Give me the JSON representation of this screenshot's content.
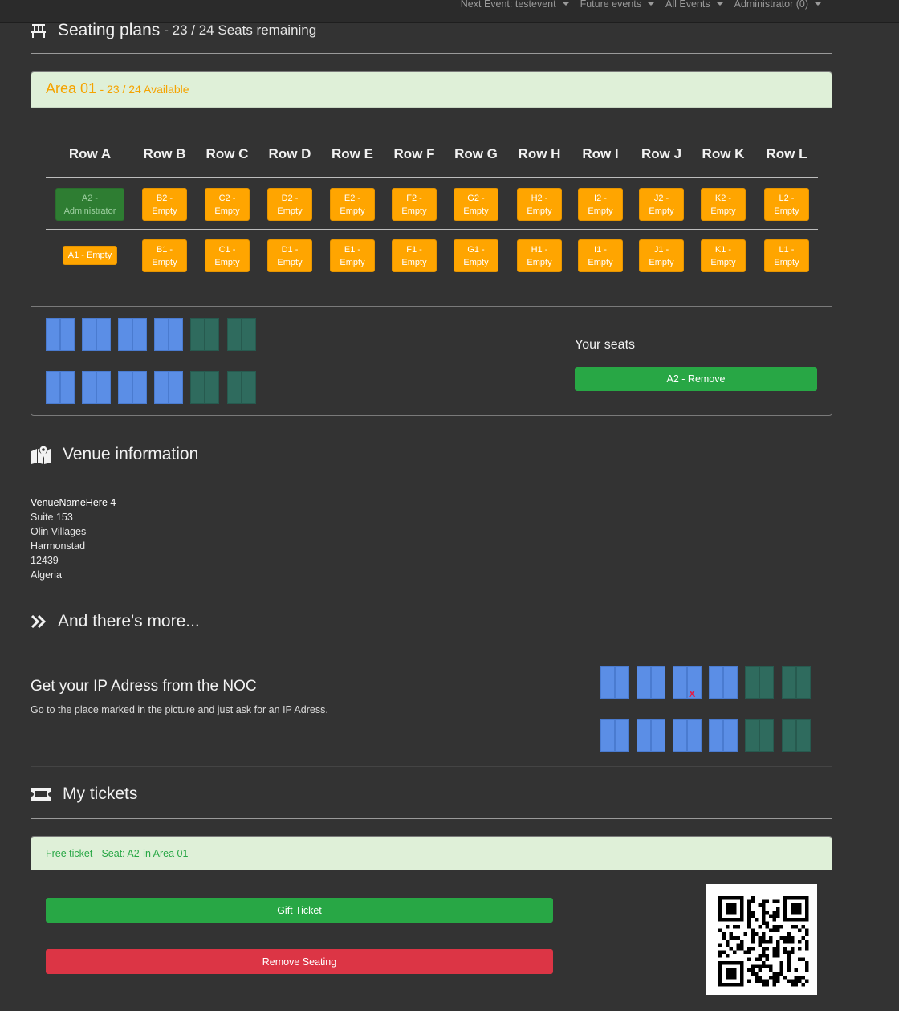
{
  "nav": {
    "next_event": "Next Event: testevent",
    "future_events": "Future events",
    "all_events": "All Events",
    "user": "Administrator (0)"
  },
  "seating": {
    "title": "Seating plans",
    "subtitle": "- 23 / 24 Seats remaining",
    "icon": "chair-icon",
    "area": {
      "name": "Area 01",
      "availability": "- 23 / 24 Available",
      "rows": [
        "Row A",
        "Row B",
        "Row C",
        "Row D",
        "Row E",
        "Row F",
        "Row G",
        "Row H",
        "Row I",
        "Row J",
        "Row K",
        "Row L"
      ],
      "seats_top": [
        {
          "line1": "A2 -",
          "line2": "Administrator",
          "taken": true
        },
        {
          "line1": "B2 -",
          "line2": "Empty"
        },
        {
          "line1": "C2 -",
          "line2": "Empty"
        },
        {
          "line1": "D2 -",
          "line2": "Empty"
        },
        {
          "line1": "E2 -",
          "line2": "Empty"
        },
        {
          "line1": "F2 -",
          "line2": "Empty"
        },
        {
          "line1": "G2 -",
          "line2": "Empty"
        },
        {
          "line1": "H2 -",
          "line2": "Empty"
        },
        {
          "line1": "I2 -",
          "line2": "Empty"
        },
        {
          "line1": "J2 -",
          "line2": "Empty"
        },
        {
          "line1": "K2 -",
          "line2": "Empty"
        },
        {
          "line1": "L2 -",
          "line2": "Empty"
        }
      ],
      "seats_bottom": [
        {
          "line1": "A1 - Empty",
          "line2": ""
        },
        {
          "line1": "B1 -",
          "line2": "Empty"
        },
        {
          "line1": "C1 -",
          "line2": "Empty"
        },
        {
          "line1": "D1 -",
          "line2": "Empty"
        },
        {
          "line1": "E1 -",
          "line2": "Empty"
        },
        {
          "line1": "F1 -",
          "line2": "Empty"
        },
        {
          "line1": "G1 -",
          "line2": "Empty"
        },
        {
          "line1": "H1 -",
          "line2": "Empty"
        },
        {
          "line1": "I1 -",
          "line2": "Empty"
        },
        {
          "line1": "J1 -",
          "line2": "Empty"
        },
        {
          "line1": "K1 -",
          "line2": "Empty"
        },
        {
          "line1": "L1 -",
          "line2": "Empty"
        }
      ],
      "your_seats_label": "Your seats",
      "remove_button": "A2 - Remove"
    },
    "colors": {
      "available": "#ffa500",
      "taken": "#2e7d32",
      "header_bg": "#dff0d8",
      "map_blue": "#5b8ee6",
      "map_teal": "#2f6b5e"
    }
  },
  "venue": {
    "title": "Venue information",
    "icon": "map-marker-icon",
    "lines": [
      "VenueNameHere 4",
      "Suite 153",
      "Olin Villages",
      "Harmonstad",
      "12439",
      "Algeria"
    ]
  },
  "more": {
    "title": "And there's more...",
    "icon": "double-chevron-right-icon",
    "item_title": "Get your IP Adress from the NOC",
    "item_desc": "Go to the place marked in the picture and just ask for an IP Adress.",
    "marker": "x"
  },
  "tickets": {
    "title": "My tickets",
    "icon": "ticket-icon",
    "ticket_label": "Free ticket - Seat: A2",
    "ticket_area": "in Area 01",
    "gift_button": "Gift Ticket",
    "remove_button": "Remove Seating",
    "qr_icon": "qr-code-icon"
  }
}
